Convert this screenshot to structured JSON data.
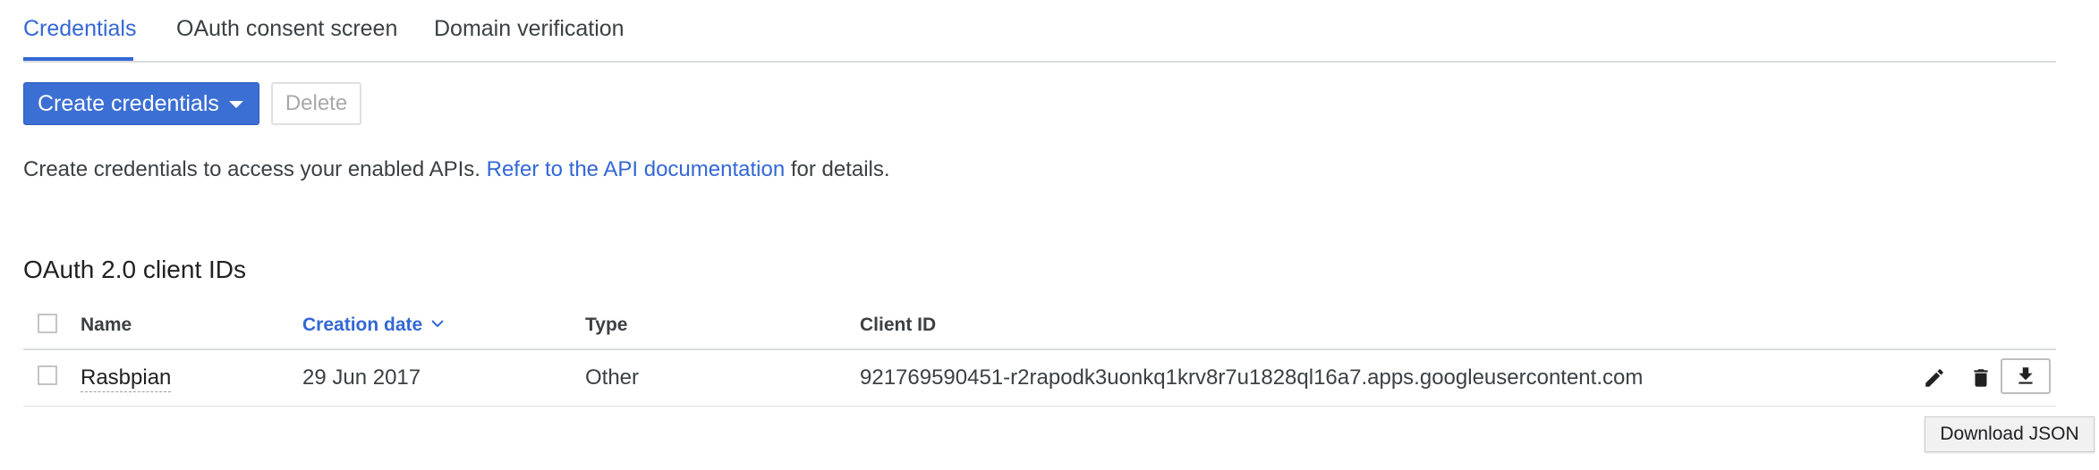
{
  "tabs": [
    {
      "label": "Credentials",
      "active": true
    },
    {
      "label": "OAuth consent screen",
      "active": false
    },
    {
      "label": "Domain verification",
      "active": false
    }
  ],
  "toolbar": {
    "create_label": "Create credentials",
    "delete_label": "Delete"
  },
  "intro": {
    "text_before": "Create credentials to access your enabled APIs. ",
    "link_text": "Refer to the API documentation",
    "text_after": " for details."
  },
  "section": {
    "title": "OAuth 2.0 client IDs"
  },
  "table": {
    "columns": {
      "name": "Name",
      "creation_date": "Creation date",
      "type": "Type",
      "client_id": "Client ID"
    },
    "rows": [
      {
        "name": "Rasbpian",
        "creation_date": "29 Jun 2017",
        "type": "Other",
        "client_id": "921769590451-r2rapodk3uonkq1krv8r7u1828ql16a7.apps.googleusercontent.com"
      }
    ]
  },
  "tooltip": {
    "text": "Download JSON"
  },
  "colors": {
    "accent": "#3367d6",
    "primary_button": "#3b6fd4"
  },
  "icons": [
    "chevron-down-icon",
    "sort-chevron-icon",
    "pencil-icon",
    "trash-icon",
    "download-icon"
  ]
}
